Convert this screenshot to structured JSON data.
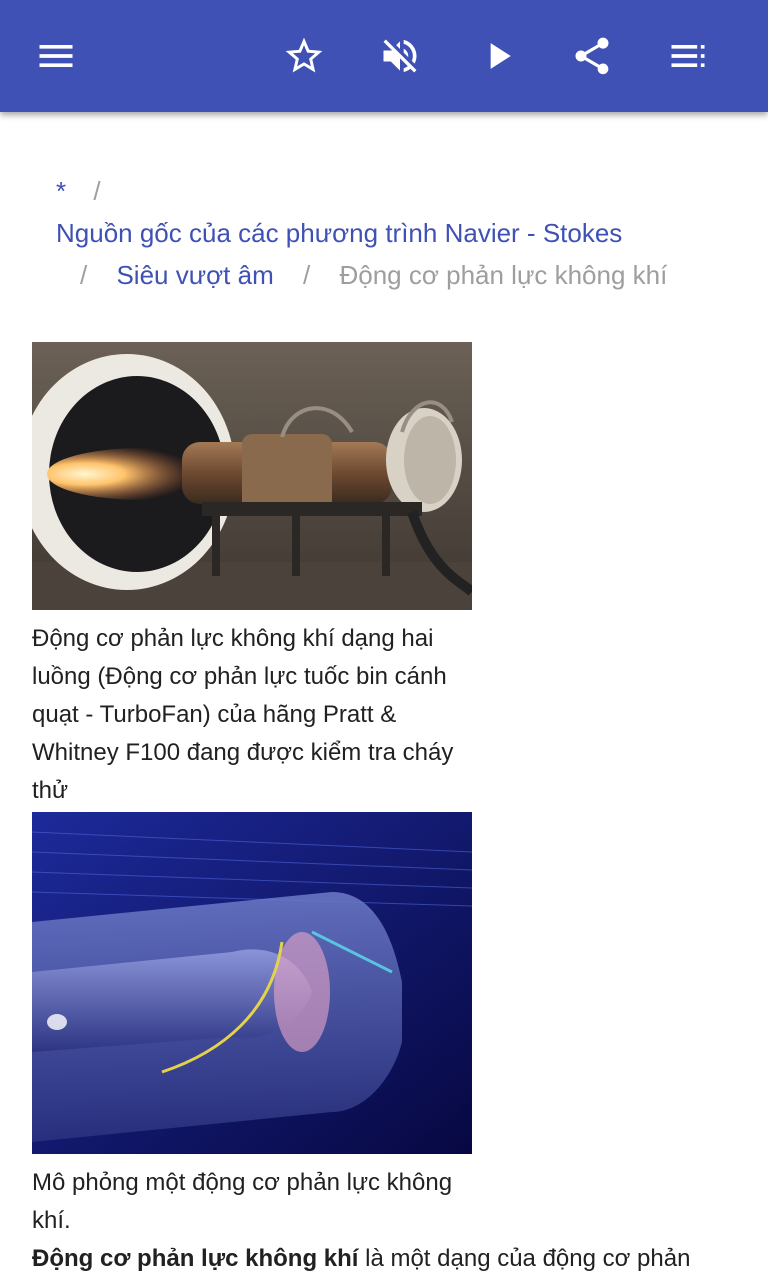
{
  "toolbar": {
    "icons": [
      "menu-icon",
      "star-icon",
      "volume-off-icon",
      "play-icon",
      "share-icon",
      "list-icon"
    ]
  },
  "breadcrumb": {
    "root": "*",
    "separator": "/",
    "item1": "Nguồn gốc của các phương trình Navier - Stokes",
    "item2": "Siêu vượt âm",
    "current": "Động cơ phản lực không khí"
  },
  "figures": [
    {
      "caption": "Động cơ phản lực không khí dạng hai luồng (Động cơ phản lực tuốc bin cánh quạt - TurboFan) của hãng Pratt & Whitney F100 đang được kiểm tra cháy thử"
    },
    {
      "caption": "Mô phỏng một động cơ phản lực không khí."
    }
  ],
  "article": {
    "lead_bold": "Động cơ phản lực không khí",
    "lead_rest": " là một dạng của động cơ phản"
  },
  "colors": {
    "appbar": "#3f51b5",
    "link": "#3f51b5",
    "muted": "#9e9e9e"
  }
}
